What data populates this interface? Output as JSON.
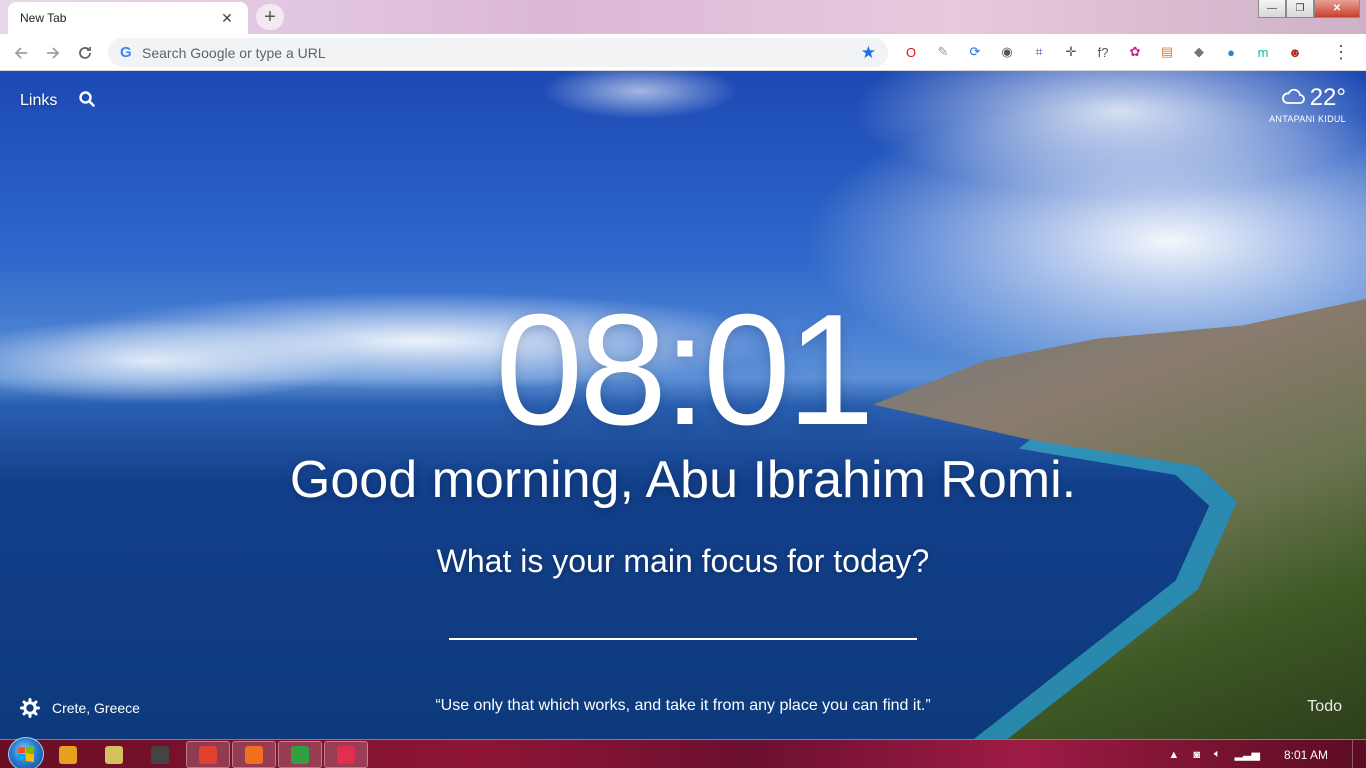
{
  "browser": {
    "tab_title": "New Tab",
    "tab_close": "✕",
    "new_tab": "+",
    "address_placeholder": "Search Google or type a URL",
    "window_controls": {
      "minimize": "—",
      "maximize": "❐",
      "close": "✕"
    }
  },
  "extensions": [
    {
      "icon": "opera-icon",
      "glyph": "O",
      "color": "#e01020"
    },
    {
      "icon": "pdf-icon",
      "glyph": "✎",
      "color": "#999999"
    },
    {
      "icon": "sync-icon",
      "glyph": "⟳",
      "color": "#1a73e8"
    },
    {
      "icon": "globe-icon",
      "glyph": "◉",
      "color": "#555555"
    },
    {
      "icon": "crop-icon",
      "glyph": "⌗",
      "color": "#3a4fb0"
    },
    {
      "icon": "move-icon",
      "glyph": "✛",
      "color": "#555555"
    },
    {
      "icon": "font-icon",
      "glyph": "f?",
      "color": "#555555"
    },
    {
      "icon": "color-picker-icon",
      "glyph": "✿",
      "color": "#d02090"
    },
    {
      "icon": "note-icon",
      "glyph": "▤",
      "color": "#d08040"
    },
    {
      "icon": "layers-icon",
      "glyph": "◆",
      "color": "#777777"
    },
    {
      "icon": "earth-icon",
      "glyph": "●",
      "color": "#2a8ad8"
    },
    {
      "icon": "m-icon",
      "glyph": "m",
      "color": "#1cb5a8"
    },
    {
      "icon": "avatar-icon",
      "glyph": "☻",
      "color": "#b03020"
    }
  ],
  "momentum": {
    "links_label": "Links",
    "weather": {
      "temp": "22°",
      "location": "ANTAPANI KIDUL"
    },
    "time": "08:01",
    "greeting": "Good morning, Abu Ibrahim Romi.",
    "focus_question": "What is your main focus for today?",
    "location": "Crete, Greece",
    "quote": "“Use only that which works, and take it from any place you can find it.”",
    "todo_label": "Todo"
  },
  "taskbar": {
    "apps": [
      {
        "name": "media-player",
        "color": "#e8a020"
      },
      {
        "name": "file-explorer",
        "color": "#d6c060"
      },
      {
        "name": "clapper",
        "color": "#444444"
      },
      {
        "name": "chrome",
        "color": "#e04030"
      },
      {
        "name": "xampp",
        "color": "#f07020"
      },
      {
        "name": "spreadsheet",
        "color": "#30a040"
      },
      {
        "name": "app-red",
        "color": "#e03050"
      }
    ],
    "time": "8:01 AM"
  }
}
